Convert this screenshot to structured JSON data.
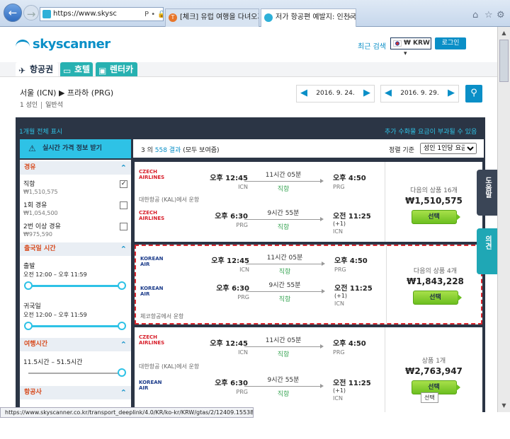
{
  "browser": {
    "url": "https://www.skysc",
    "addr_icons": "Ρ • 🔒 Skysc",
    "tabs": [
      {
        "label": "[체크] 유럽 여행을 다녀오기 ..."
      },
      {
        "label": "저가 항공편 예발지: 인천국..."
      }
    ],
    "status_url": "https://www.skyscanner.co.kr/transport_deeplink/4.0/KR/ko-kr/KRW/gtas/2/12409.15538.2..."
  },
  "header": {
    "logo": "skyscanner",
    "recent": "최근 검색",
    "currency": "₩ KRW ▾",
    "login": "로그인"
  },
  "service_tabs": [
    {
      "label": "항공권",
      "icon": "✈"
    },
    {
      "label": "호텔",
      "icon": "▭"
    },
    {
      "label": "렌터카",
      "icon": "▣"
    }
  ],
  "search": {
    "route": "서울 (ICN) ▶ 프라하 (PRG)",
    "passengers": "1 성인",
    "cabin": "일반석",
    "depart_date": "2016. 9. 24.",
    "return_date": "2016. 9. 29."
  },
  "month_link": "1개월 전체 표시",
  "fee_notice": "추가 수화물 요금이 부과될 수 있음",
  "alert_btn": "실시간 가격 정보 받기",
  "filters": {
    "stops_title": "경유",
    "stops": [
      {
        "label": "직항",
        "price": "₩1,510,575",
        "checked": "✓"
      },
      {
        "label": "1회 경유",
        "price": "₩1,054,500",
        "checked": ""
      },
      {
        "label": "2번 이상 경유",
        "price": "₩975,590",
        "checked": ""
      }
    ],
    "times_title": "출국일 시간",
    "outbound_label": "출발",
    "outbound_range": "오전 12:00 – 오후 11:59",
    "return_label": "귀국일",
    "return_range": "오전 12:00 – 오후 11:59",
    "duration_title": "여행시간",
    "duration_range": "11.5시간 – 51.5시간",
    "airline_title": "항공사"
  },
  "results": {
    "count_prefix": "3 의",
    "count_total": "558 결과",
    "count_suffix": "(모두 보여줌)",
    "sort_label": "정렬 기준",
    "sort_value": "성인 1인당 요금"
  },
  "cards": [
    {
      "out": {
        "airline": "CZECH AIRLINES",
        "dep": "오후 12:45",
        "dep_ap": "ICN",
        "dur": "11시간 05분",
        "stop": "직항",
        "arr": "오후 4:50",
        "arr_ap": "PRG",
        "plus": ""
      },
      "operator1": "대한항공 (KAL)에서 운항",
      "ret": {
        "airline": "CZECH AIRLINES",
        "dep": "오후 6:30",
        "dep_ap": "PRG",
        "dur": "9시간 55분",
        "stop": "직항",
        "arr": "오전 11:25",
        "arr_ap": "ICN",
        "plus": "(+1)"
      },
      "operator2": "",
      "deals": "다음의 상품 16개",
      "price": "₩1,510,575",
      "select": "선택"
    },
    {
      "out": {
        "airline": "KOREAN AIR",
        "dep": "오후 12:45",
        "dep_ap": "ICN",
        "dur": "11시간 05분",
        "stop": "직항",
        "arr": "오후 4:50",
        "arr_ap": "PRG",
        "plus": ""
      },
      "operator1": "",
      "ret": {
        "airline": "KOREAN AIR",
        "dep": "오후 6:30",
        "dep_ap": "PRG",
        "dur": "9시간 55분",
        "stop": "직항",
        "arr": "오전 11:25",
        "arr_ap": "ICN",
        "plus": "(+1)"
      },
      "operator2": "체코항공에서 운항",
      "deals": "다음의 상품 4개",
      "price": "₩1,843,228",
      "select": "선택"
    },
    {
      "out": {
        "airline": "CZECH AIRLINES",
        "dep": "오후 12:45",
        "dep_ap": "ICN",
        "dur": "11시간 05분",
        "stop": "직항",
        "arr": "오후 4:50",
        "arr_ap": "PRG",
        "plus": ""
      },
      "operator1": "대한항공 (KAL)에서 운항",
      "ret": {
        "airline": "KOREAN AIR",
        "dep": "오후 6:30",
        "dep_ap": "PRG",
        "dur": "9시간 55분",
        "stop": "직항",
        "arr": "오전 11:25",
        "arr_ap": "ICN",
        "plus": "(+1)"
      },
      "operator2": "",
      "deals": "상품 1개",
      "price": "₩2,763,947",
      "select": "선택"
    }
  ],
  "tooltip": "선택",
  "side_tabs": [
    "도움말",
    "의견"
  ],
  "colors": {
    "brand": "#0a8fc7",
    "accent": "#2ec2e6",
    "highlight": "#d9282f",
    "select_btn": "#6cbf1f"
  }
}
